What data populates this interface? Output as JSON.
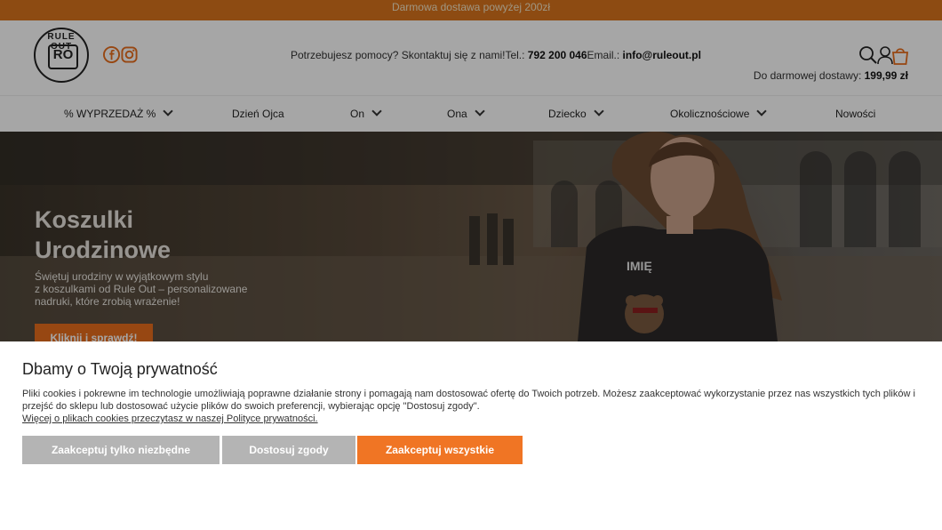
{
  "topbar": {
    "text": "Darmowa dostawa powyżej 200zł"
  },
  "logo": {
    "text_top": "RULE OUT",
    "text_mark": "RO"
  },
  "header": {
    "help_text": "Potrzebujesz pomocy? Skontaktuj się z nami!",
    "tel_label": "Tel.: ",
    "tel": "792 200 046",
    "email_label": "Email.: ",
    "email": "info@ruleout.pl",
    "shipping_label": "Do darmowej dostawy: ",
    "shipping_value": "199,99 zł"
  },
  "icons": {
    "facebook": "facebook-icon",
    "instagram": "instagram-icon",
    "search": "search-icon",
    "user": "user-icon",
    "cart": "cart-icon"
  },
  "nav": {
    "items": [
      {
        "label": "% WYPRZEDAŻ %"
      },
      {
        "label": "Dzień Ojca"
      },
      {
        "label": "On"
      },
      {
        "label": "Ona"
      },
      {
        "label": "Dziecko"
      },
      {
        "label": "Okolicznościowe"
      },
      {
        "label": "Nowości"
      }
    ]
  },
  "hero": {
    "title_line1": "Koszulki",
    "title_line2": "Urodzinowe",
    "text_line1": "Świętuj urodziny w wyjątkowym stylu",
    "text_line2": "z koszulkami od Rule Out – personalizowane",
    "text_line3": "nadruki, które zrobią wrażenie!",
    "button": "Kliknij i sprawdź!",
    "shirt_text": "IMIĘ"
  },
  "cookie": {
    "title": "Dbamy o Twoją prywatność",
    "text": "Pliki cookies i pokrewne im technologie umożliwiają poprawne działanie strony i pomagają nam dostosować ofertę do Twoich potrzeb. Możesz zaakceptować wykorzystanie przez nas wszystkich tych plików i przejść do sklepu lub dostosować użycie plików do swoich preferencji, wybierając opcję \"Dostosuj zgody\".",
    "link": "Więcej o plikach cookies przeczytasz w naszej Polityce prywatności.",
    "btn_necessary": "Zaakceptuj tylko niezbędne",
    "btn_customize": "Dostosuj zgody",
    "btn_accept": "Zaakceptuj wszystkie"
  },
  "colors": {
    "accent": "#e96e1c",
    "topbar": "#d9731c",
    "gray_button": "#b4b4b4"
  }
}
